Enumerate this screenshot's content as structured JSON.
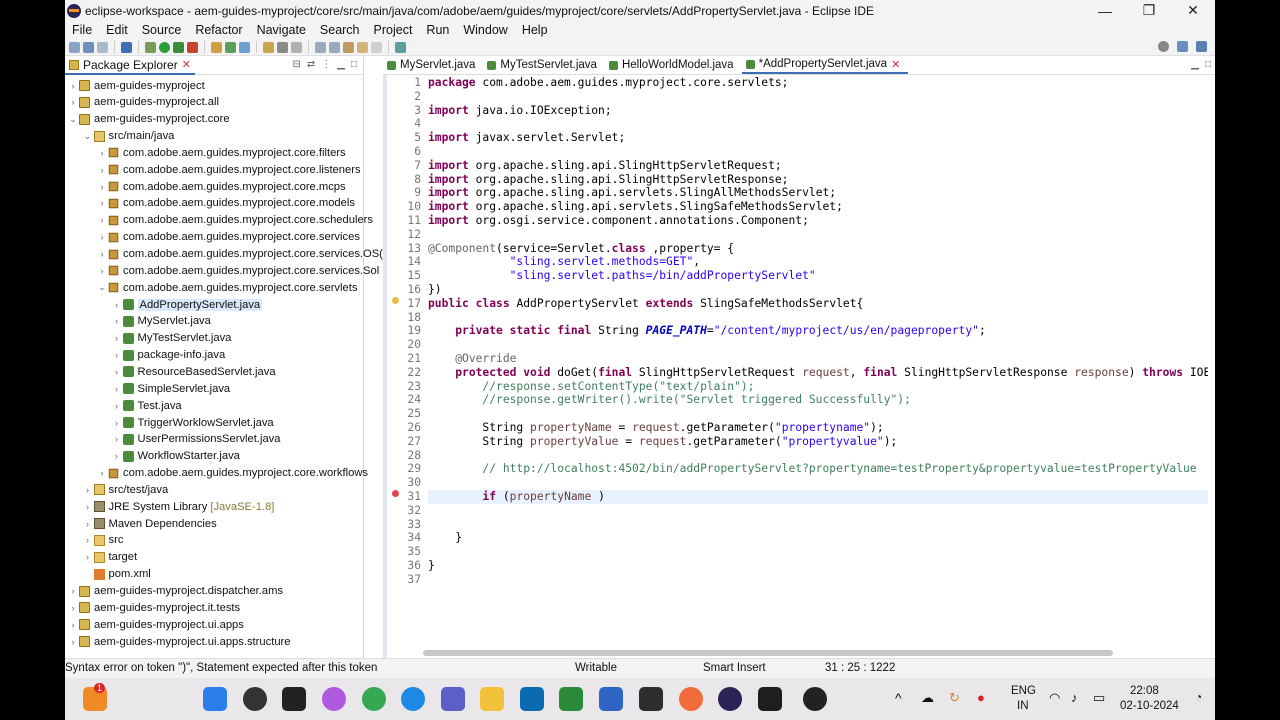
{
  "window": {
    "title": "eclipse-workspace - aem-guides-myproject/core/src/main/java/com/adobe/aem/guides/myproject/core/servlets/AddPropertyServlet.java - Eclipse IDE",
    "minimize": "—",
    "maximize": "❐",
    "close": "✕"
  },
  "menu": [
    "File",
    "Edit",
    "Source",
    "Refactor",
    "Navigate",
    "Search",
    "Project",
    "Run",
    "Window",
    "Help"
  ],
  "explorer": {
    "title": "Package Explorer",
    "items": [
      {
        "label": "aem-guides-myproject",
        "depth": 0,
        "arrow": "›",
        "icon": "proj"
      },
      {
        "label": "aem-guides-myproject.all",
        "depth": 0,
        "arrow": "›",
        "icon": "proj"
      },
      {
        "label": "aem-guides-myproject.core",
        "depth": 0,
        "arrow": "⌄",
        "icon": "proj"
      },
      {
        "label": "src/main/java",
        "depth": 1,
        "arrow": "⌄",
        "icon": "src"
      },
      {
        "label": "com.adobe.aem.guides.myproject.core.filters",
        "depth": 2,
        "arrow": "›",
        "icon": "pkg"
      },
      {
        "label": "com.adobe.aem.guides.myproject.core.listeners",
        "depth": 2,
        "arrow": "›",
        "icon": "pkg"
      },
      {
        "label": "com.adobe.aem.guides.myproject.core.mcps",
        "depth": 2,
        "arrow": "›",
        "icon": "pkg"
      },
      {
        "label": "com.adobe.aem.guides.myproject.core.models",
        "depth": 2,
        "arrow": "›",
        "icon": "pkg"
      },
      {
        "label": "com.adobe.aem.guides.myproject.core.schedulers",
        "depth": 2,
        "arrow": "›",
        "icon": "pkg"
      },
      {
        "label": "com.adobe.aem.guides.myproject.core.services",
        "depth": 2,
        "arrow": "›",
        "icon": "pkg"
      },
      {
        "label": "com.adobe.aem.guides.myproject.core.services.OS(",
        "depth": 2,
        "arrow": "›",
        "icon": "pkg"
      },
      {
        "label": "com.adobe.aem.guides.myproject.core.services.Sol",
        "depth": 2,
        "arrow": "›",
        "icon": "pkg"
      },
      {
        "label": "com.adobe.aem.guides.myproject.core.servlets",
        "depth": 2,
        "arrow": "⌄",
        "icon": "pkg"
      },
      {
        "label": "AddPropertyServlet.java",
        "depth": 3,
        "arrow": "›",
        "icon": "java",
        "selected": true
      },
      {
        "label": "MyServlet.java",
        "depth": 3,
        "arrow": "›",
        "icon": "java"
      },
      {
        "label": "MyTestServlet.java",
        "depth": 3,
        "arrow": "›",
        "icon": "java"
      },
      {
        "label": "package-info.java",
        "depth": 3,
        "arrow": "›",
        "icon": "java"
      },
      {
        "label": "ResourceBasedServlet.java",
        "depth": 3,
        "arrow": "›",
        "icon": "java"
      },
      {
        "label": "SimpleServlet.java",
        "depth": 3,
        "arrow": "›",
        "icon": "java"
      },
      {
        "label": "Test.java",
        "depth": 3,
        "arrow": "›",
        "icon": "java"
      },
      {
        "label": "TriggerWorklowServlet.java",
        "depth": 3,
        "arrow": "›",
        "icon": "java"
      },
      {
        "label": "UserPermissionsServlet.java",
        "depth": 3,
        "arrow": "›",
        "icon": "java"
      },
      {
        "label": "WorkflowStarter.java",
        "depth": 3,
        "arrow": "›",
        "icon": "java"
      },
      {
        "label": "com.adobe.aem.guides.myproject.core.workflows",
        "depth": 2,
        "arrow": "›",
        "icon": "pkg"
      },
      {
        "label": "src/test/java",
        "depth": 1,
        "arrow": "›",
        "icon": "src"
      },
      {
        "label": "JRE System Library",
        "deco": "[JavaSE-1.8]",
        "depth": 1,
        "arrow": "›",
        "icon": "lib"
      },
      {
        "label": "Maven Dependencies",
        "depth": 1,
        "arrow": "›",
        "icon": "lib"
      },
      {
        "label": "src",
        "depth": 1,
        "arrow": "›",
        "icon": "fold"
      },
      {
        "label": "target",
        "depth": 1,
        "arrow": "›",
        "icon": "fold"
      },
      {
        "label": "pom.xml",
        "depth": 1,
        "arrow": "",
        "icon": "xml"
      },
      {
        "label": "aem-guides-myproject.dispatcher.ams",
        "depth": 0,
        "arrow": "›",
        "icon": "proj"
      },
      {
        "label": "aem-guides-myproject.it.tests",
        "depth": 0,
        "arrow": "›",
        "icon": "proj"
      },
      {
        "label": "aem-guides-myproject.ui.apps",
        "depth": 0,
        "arrow": "›",
        "icon": "proj"
      },
      {
        "label": "aem-guides-myproject.ui.apps.structure",
        "depth": 0,
        "arrow": "›",
        "icon": "proj"
      }
    ]
  },
  "editor": {
    "tabs": [
      {
        "label": "MyServlet.java"
      },
      {
        "label": "MyTestServlet.java"
      },
      {
        "label": "HelloWorldModel.java"
      },
      {
        "label": "*AddPropertyServlet.java",
        "active": true
      }
    ],
    "lines": [
      [
        [
          "kw",
          "package"
        ],
        [
          "",
          "com.adobe.aem.guides.myproject.core.servlets;"
        ]
      ],
      [],
      [
        [
          "kw",
          "import"
        ],
        [
          "",
          "java.io.IOException;"
        ]
      ],
      [],
      [
        [
          "kw",
          "import"
        ],
        [
          "",
          "javax.servlet.Servlet;"
        ]
      ],
      [],
      [
        [
          "kw",
          "import"
        ],
        [
          "",
          "org.apache.sling.api.SlingHttpServletRequest;"
        ]
      ],
      [
        [
          "kw",
          "import"
        ],
        [
          "",
          "org.apache.sling.api.SlingHttpServletResponse;"
        ]
      ],
      [
        [
          "kw",
          "import"
        ],
        [
          "",
          "org.apache.sling.api.servlets.SlingAllMethodsServlet;"
        ]
      ],
      [
        [
          "kw",
          "import"
        ],
        [
          "",
          "org.apache.sling.api.servlets.SlingSafeMethodsServlet;"
        ]
      ],
      [
        [
          "kw",
          "import"
        ],
        [
          "",
          "org.osgi.service.component.annotations.Component;"
        ]
      ],
      [],
      [
        [
          "an",
          "@Component"
        ],
        [
          "",
          "(service=Servlet."
        ],
        [
          "kw",
          "class"
        ],
        [
          "",
          ",property= {"
        ]
      ],
      [
        [
          "",
          "            "
        ],
        [
          "str",
          "\"sling.servlet.methods=GET\""
        ],
        [
          "",
          ","
        ]
      ],
      [
        [
          "",
          "            "
        ],
        [
          "str",
          "\"sling.servlet.paths=/bin/addPropertyServlet\""
        ]
      ],
      [
        [
          "",
          "})"
        ]
      ],
      [
        [
          "kw",
          "public class"
        ],
        [
          "",
          "AddPropertyServlet "
        ],
        [
          "kw",
          "extends"
        ],
        [
          "",
          "SlingSafeMethodsServlet{"
        ]
      ],
      [],
      [
        [
          "",
          "    "
        ],
        [
          "kw",
          "private static final"
        ],
        [
          "",
          "String "
        ],
        [
          "fld",
          "PAGE_PATH"
        ],
        [
          "",
          "="
        ],
        [
          "str",
          "\"/content/myproject/us/en/pageproperty\""
        ],
        [
          "",
          ";"
        ]
      ],
      [],
      [
        [
          "",
          "    "
        ],
        [
          "an",
          "@Override"
        ]
      ],
      [
        [
          "",
          "    "
        ],
        [
          "kw",
          "protected void"
        ],
        [
          "",
          "doGet("
        ],
        [
          "kw",
          "final"
        ],
        [
          "",
          "SlingHttpServletRequest "
        ],
        [
          "prm",
          "request"
        ],
        [
          "",
          ", "
        ],
        [
          "kw",
          "final"
        ],
        [
          "",
          "SlingHttpServletResponse "
        ],
        [
          "prm",
          "response"
        ],
        [
          "",
          ") "
        ],
        [
          "kw",
          "throws"
        ],
        [
          "",
          "IOExc"
        ]
      ],
      [
        [
          "",
          "        "
        ],
        [
          "cm",
          "//response.setContentType(\"text/plain\");"
        ]
      ],
      [
        [
          "",
          "        "
        ],
        [
          "cm",
          "//response.getWriter().write(\"Servlet triggered Successfully\");"
        ]
      ],
      [],
      [
        [
          "",
          "        String "
        ],
        [
          "prm",
          "propertyName"
        ],
        [
          "",
          " = "
        ],
        [
          "prm",
          "request"
        ],
        [
          "",
          ".getParameter("
        ],
        [
          "str",
          "\"propertyname\""
        ],
        [
          "",
          ");"
        ]
      ],
      [
        [
          "",
          "        String "
        ],
        [
          "prm",
          "propertyValue"
        ],
        [
          "",
          " = "
        ],
        [
          "prm",
          "request"
        ],
        [
          "",
          ".getParameter("
        ],
        [
          "str",
          "\"propertyvalue\""
        ],
        [
          "",
          ");"
        ]
      ],
      [],
      [
        [
          "",
          "        "
        ],
        [
          "cm",
          "// http://localhost:4502/bin/addPropertyServlet?propertyname=testProperty&propertyvalue=testPropertyValue"
        ]
      ],
      [],
      [
        [
          "",
          "        "
        ],
        [
          "kw",
          "if"
        ],
        [
          "",
          "("
        ],
        [
          "prm",
          "propertyName"
        ],
        [
          "",
          " )"
        ]
      ],
      [],
      [],
      [
        [
          "",
          "    }"
        ]
      ],
      [],
      [
        [
          "",
          "}"
        ]
      ],
      []
    ]
  },
  "status": {
    "message": "Syntax error on token \")\", Statement expected after this token",
    "mode": "Writable",
    "insert": "Smart Insert",
    "position": "31 : 25 : 1222"
  },
  "taskbar": {
    "lang": "ENG",
    "region": "IN",
    "time": "22:08",
    "date": "02-10-2024",
    "badge": "1"
  }
}
